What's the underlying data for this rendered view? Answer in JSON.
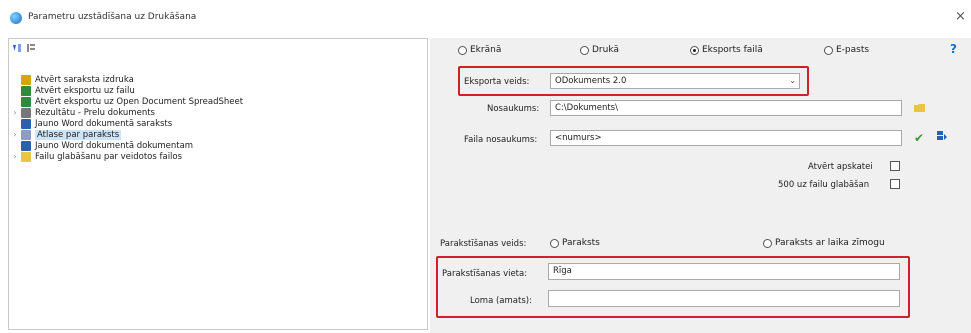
{
  "window": {
    "title": "Parametru uzstādīšana uz Drukāšana",
    "close_glyph": "×"
  },
  "tree": {
    "items": [
      {
        "label": "Atvērt saraksta izdruka",
        "icon": "report-icon",
        "color": "#d9a400",
        "expandable": false,
        "selected": false
      },
      {
        "label": "Atvērt eksportu uz failu",
        "icon": "excel-icon",
        "color": "#2e8b3d",
        "expandable": false,
        "selected": false
      },
      {
        "label": "Atvērt eksportu uz Open Document SpreadSheet",
        "icon": "spreadsheet-icon",
        "color": "#2e8b3d",
        "expandable": false,
        "selected": false
      },
      {
        "label": "Rezultātu - Prelu dokuments",
        "icon": "document-icon",
        "color": "#777777",
        "expandable": true,
        "selected": false
      },
      {
        "label": "Jauno Word dokumentā saraksts",
        "icon": "word-icon",
        "color": "#2b5fb4",
        "expandable": false,
        "selected": false
      },
      {
        "label": "Atlase par paraksts",
        "icon": "folder-icon",
        "color": "#8a9fc0",
        "expandable": true,
        "selected": true
      },
      {
        "label": "Jauno Word dokumentā dokumentam",
        "icon": "word-icon",
        "color": "#2b5fb4",
        "expandable": false,
        "selected": false
      },
      {
        "label": "Failu glabāšanu par veidotos failos",
        "icon": "folder-icon",
        "color": "#e8c547",
        "expandable": true,
        "selected": false
      }
    ]
  },
  "output_mode": {
    "options": [
      "Ekrānā",
      "Drukā",
      "Eksports failā",
      "E-pasts"
    ],
    "selected": 2
  },
  "export": {
    "type_label": "Eksporta veids:",
    "type_value": "ODokuments 2.0",
    "folder_label": "Nosaukums:",
    "folder_value": "C:\\Dokuments\\",
    "filename_label": "Faila nosaukums:",
    "filename_value": "<numurs>",
    "open_after_label": "Atvērt apskatei",
    "open_after_checked": false,
    "save_label": "500 uz failu glabāšan",
    "save_checked": false
  },
  "signature": {
    "type_label": "Parakstīšanas veids:",
    "options": [
      "Paraksts",
      "Paraksts ar laika zīmogu"
    ],
    "selected": -1,
    "place_label": "Parakstīšanas vieta:",
    "place_value": "Rīga",
    "role_label": "Loma (amats):",
    "role_value": ""
  },
  "accent": {
    "highlight": "#d0202a",
    "selection": "#cce4f7",
    "check_green": "#3a9a3a"
  }
}
